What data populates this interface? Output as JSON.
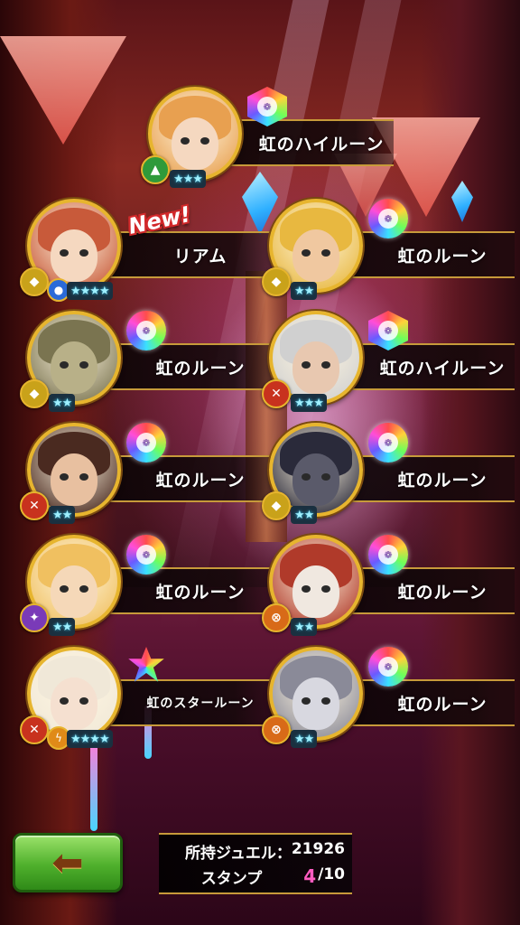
{
  "rewards": [
    {
      "name": "虹のハイルーン",
      "rune": "hex",
      "element": "green",
      "stars": "★★★",
      "new": ""
    },
    {
      "name": "リアム",
      "rune": "",
      "element": "yellow",
      "stars": "★★★★",
      "new": "New!"
    },
    {
      "name": "虹のルーン",
      "rune": "round",
      "element": "yellow",
      "stars": "★★",
      "new": ""
    },
    {
      "name": "虹のルーン",
      "rune": "round",
      "element": "yellow",
      "stars": "★★",
      "new": ""
    },
    {
      "name": "虹のハイルーン",
      "rune": "hex",
      "element": "red",
      "stars": "★★★",
      "new": ""
    },
    {
      "name": "虹のルーン",
      "rune": "round",
      "element": "red",
      "stars": "★★",
      "new": ""
    },
    {
      "name": "虹のルーン",
      "rune": "round",
      "element": "yellow",
      "stars": "★★",
      "new": ""
    },
    {
      "name": "虹のルーン",
      "rune": "round",
      "element": "purple",
      "stars": "★★",
      "new": ""
    },
    {
      "name": "虹のルーン",
      "rune": "round",
      "element": "orange",
      "stars": "★★",
      "new": ""
    },
    {
      "name": "虹のスタールーン",
      "rune": "star",
      "element": "red",
      "stars": "★★★★",
      "new": ""
    },
    {
      "name": "虹のルーン",
      "rune": "round",
      "element": "orange",
      "stars": "★★",
      "new": ""
    }
  ],
  "footer": {
    "jewel_label": "所持ジュエル：",
    "jewel_value": "21926",
    "stamp_label": "スタンプ",
    "stamp_current": "4",
    "stamp_total": "/10",
    "back_icon": "arrow-left-icon"
  },
  "colors": {
    "accent": "#ff5cc0",
    "frame_gold": "#e7b52e",
    "button_green": "#4fb02c"
  }
}
